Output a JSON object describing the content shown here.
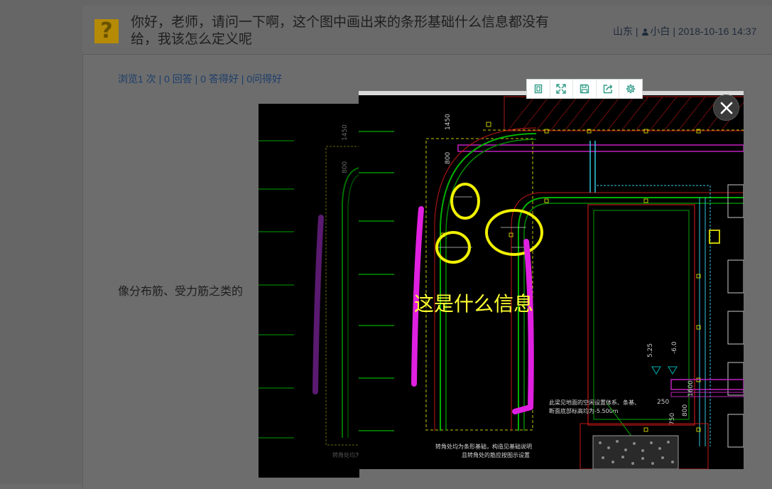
{
  "question": {
    "title": "你好，老师，请问一下啊，这个图中画出来的条形基础什么信息都没有给，我该怎么定义呢",
    "icon": "question-mark-icon",
    "icon_glyph": "?",
    "location": "山东",
    "author": "小白",
    "date": "2018-10-16 14:37",
    "separator": "|"
  },
  "stats": {
    "views": "浏览1 次",
    "answers": "0 回答",
    "good_answers": "0 答得好",
    "questions_good": "0问得好"
  },
  "body_text": "像分布筋、受力筋之类的",
  "viewer": {
    "annotation": "这是什么信息",
    "toolbar": [
      {
        "name": "original-size-icon"
      },
      {
        "name": "fullscreen-icon"
      },
      {
        "name": "save-icon"
      },
      {
        "name": "share-icon"
      },
      {
        "name": "settings-icon"
      }
    ],
    "close": "close-icon",
    "drawing_labels": {
      "dim_1450": "1450",
      "dim_800": "800",
      "dim_750": "750",
      "elev_525": "5.25",
      "elev_6": "-6.0",
      "dim_1600": "1600",
      "dim_250": "250",
      "dim_800b": "800",
      "note_1": "此梁见地面的空闲设置体系、条基、",
      "note_2": "断面底部标高均为-5.500m",
      "note_3": "转角处均为条形基础，构造见基础说明",
      "note_4": "且转角处的筋应按图示设置",
      "note_back": "转角处均为条"
    }
  },
  "colors": {
    "annotation_yellow": "#ffff30",
    "magenta": "#e020e0",
    "cad_green": "#00c000",
    "cad_red": "#e02020",
    "cad_cyan": "#30c8e0"
  }
}
